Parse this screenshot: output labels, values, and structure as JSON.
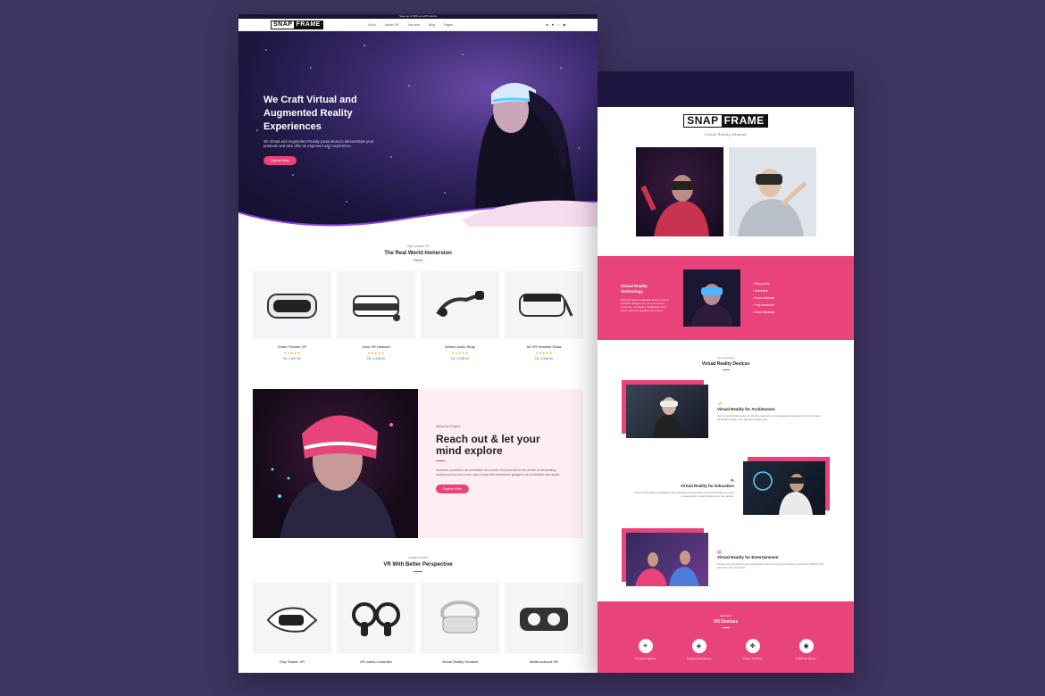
{
  "left": {
    "promo": "Save up to 50% on all Products",
    "logo": {
      "part1": "SNAP",
      "part2": "FRAME"
    },
    "menu": [
      "Home",
      "About VR",
      "Join now",
      "Blog",
      "Pages"
    ],
    "hero": {
      "title": "We Craft Virtual and Augmented Reality Experiences",
      "text": "3D Virtual and Augmented Reality panoramas to demonstrate your products and also offer an improved user experience.",
      "button": "Explore More"
    },
    "section1": {
      "eyebrow": "High Quality VR",
      "title": "The Real World Immersion"
    },
    "products": [
      {
        "name": "Smart Theater VR",
        "stars": "★★★★★",
        "price": "Rs. 3,697.00"
      },
      {
        "name": "Gear VR Headset",
        "stars": "★★★★★",
        "price": "Rs. 3,238.00"
      },
      {
        "name": "Deluxe Audio Strap",
        "stars": "★★★★★",
        "price": "Rs. 3,238.00"
      },
      {
        "name": "3D VR Headset Glass",
        "stars": "★★★★★",
        "price": "Rs. 3,528.00"
      }
    ],
    "about": {
      "eyebrow": "About the Project",
      "title": "Reach out & let your mind explore",
      "text": "Immerse yourself in an incredible new world, find yourself in the center of fascinating scenes and try out a new way to play with immersive gadget in an incredible new world.",
      "button": "Explore More"
    },
    "section2": {
      "eyebrow": "Latest Arrivals",
      "title": "VR With Better Perspective"
    },
    "products2": [
      {
        "name": "Play Station VR"
      },
      {
        "name": "VR motion controller"
      },
      {
        "name": "Virtual Reality Headset"
      },
      {
        "name": "Multifunctional VR"
      }
    ]
  },
  "right": {
    "logo": {
      "part1": "SNAP",
      "part2": "FRAME"
    },
    "tagline": "Virtual Reality Headset",
    "band": {
      "title": "Virtual Reality Technology",
      "text": "Sed ante ipsum vulputate lectus porta ut tincidunt. Aliquam ac et ornare ipsum, turpis leo, massa dui. Vestibulum ante ipsum primis in faucibus orci luctus.",
      "list": [
        "Responsive",
        "Interactive",
        "Home Assistant",
        "Fully Immersive",
        "Most Affordable"
      ]
    },
    "devices": {
      "eyebrow": "New Headsets",
      "title": "Virtual Reality Devices"
    },
    "features": [
      {
        "title": "Virtual Reality for Architecture",
        "text": "Sed ut perspiciatis unde omnis iste natus error sit voluptatem accusantium doloremque laudantium totam rem aperiam eaque ipsa."
      },
      {
        "title": "Virtual Reality for Education",
        "text": "Nemo enim ipsam voluptatem quia voluptas sit aspernatur aut odit aut fugit sed quia consequuntur magni dolores eos qui ratione."
      },
      {
        "title": "Virtual Reality for Entertainment",
        "text": "Neque porro quisquam est qui dolorem ipsum quia dolor sit amet consectetur adipisci velit sed quia non numquam."
      }
    ],
    "bottom": {
      "eyebrow": "High-Tech",
      "title": "VR Devices",
      "items": [
        "Dynamic Lighting",
        "Fastened Rendering",
        "Motion Tracking",
        "Positional Sensor"
      ]
    }
  },
  "colors": {
    "accent": "#e8437a",
    "dark": "#1d1640",
    "background": "#3d3461"
  }
}
